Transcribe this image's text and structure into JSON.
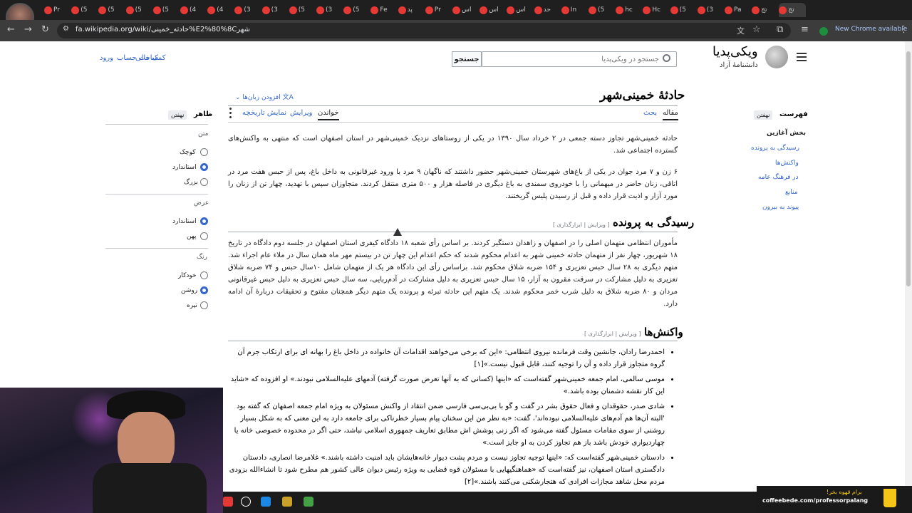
{
  "browser": {
    "tabs": [
      "Pr",
      "(5",
      "(5",
      "(5",
      "(5",
      "(4",
      "(4",
      "(3",
      "(3",
      "(5",
      "(3",
      "(5",
      "Fe",
      "پد",
      "Pr",
      "اس",
      "اس",
      "اس",
      "حد",
      "In",
      "(5",
      "hc",
      "Hc",
      "(5",
      "(3",
      "Pa",
      "تج",
      "تج"
    ],
    "url": "fa.wikipedia.org/wiki/حادثه_خمینی%E2%80%8Cشهر",
    "new_chrome": "New Chrome available"
  },
  "wiki": {
    "logo_title": "ویکی‌پدیا",
    "logo_tagline": "دانشنامهٔ آزاد",
    "search_placeholder": "جستجو در ویکی‌پدیا",
    "search_button": "جستجو",
    "top_links": [
      "کمک مالی",
      "ساخت حساب",
      "ورود"
    ],
    "page_title": "حادثهٔ خمینی‌شهر",
    "add_languages": "افزودن زبان‌ها",
    "tabs": {
      "article": "مقاله",
      "talk": "بحث",
      "read": "خواندن",
      "edit": "ویرایش",
      "history": "نمایش تاریخچه"
    },
    "intro_1": "حادثه خمینی‌شهر تجاوز دسته جمعی در ۲ خرداد سال ۱۳۹۰ در یکی از روستاهای نزدیک خمینی‌شهر در استان اصفهان است که منتهی به واکنش‌های گسترده اجتماعی شد.",
    "intro_2": "۶ زن و ۷ مرد جوان در یکی از باغ‌های شهرستان خمینی‌شهر حضور داشتند که ناگهان ۹ مرد با ورود غیرقانونی به داخل باغ، پس از حبس هفت مرد در اتاقی، زنان حاضر در میهمانی را با خودروی سمندی به باغ دیگری در فاصله هزار و ۵۰۰ متری منتقل کردند. متجاوزان سپس با تهدید، چهار تن از زنان را مورد آزار و اذیت قرار داده و قبل از رسیدن پلیس گریختند.",
    "section_1": "رسیدگی به پرونده",
    "edit_links": "[ ویرایش | ابزارگذاری ]",
    "section_1_text": "مأموران انتظامی متهمان اصلی را در اصفهان و زاهدان دستگیر کردند. بر اساس رأی شعبه ۱۸ دادگاه کیفری استان اصفهان در جلسه دوم دادگاه در تاریخ ۱۸ شهریور، چهار نفر از متهمان حادثه خمینی شهر به اعدام محکوم شدند که حکم اعدام این چهار تن در بیستم مهر ماه همان سال در ملاء عام اجراء شد. متهم دیگری به ۲۸ سال حبس تعزیری و ۱۵۴ ضربه شلاق محکوم شد. براساس رأی این دادگاه هر یک از متهمان شامل ۱۰سال حبس و ۷۴ ضربه شلاق تعزیری به دلیل مشارکت در سرقت مقرون به آزار، ۱۵ سال حبس تعزیری به دلیل مشارکت در آدم‌ربایی، سه سال حبس تعزیری به دلیل حبس غیرقانونی مردان و ۸۰ ضربه شلاق به دلیل شرب خمر محکوم شدند. یک متهم این حادثه تبرئه و پرونده یک متهم دیگر همچنان مفتوح و تحقیقات دربارهٔ آن ادامه دارد.",
    "section_2": "واکنش‌ها",
    "reactions": [
      "احمدرضا رادان، جانشین وقت فرمانده نیروی انتظامی: «این که برخی می‌خواهند اقدامات آن خانواده در داخل باغ را بهانه ای برای ارتکاب جرم آن گروه متجاوز قرار داده و آن را توجیه کنند، قابل قبول نیست.»[۱]",
      "موسی سالمی، امام جمعه خمینی‌شهر گفته‌است که «اینها (کسانی که به آنها تعرض صورت گرفته) آدمهای علیه‌السلامی نبودند.» او افزوده که «شاید این کار نقشه دشمنان بوده باشد.»",
      "شادی صدر، حقوقدان و فعال حقوق بشر در گفت و گو با بی‌بی‌سی فارسی ضمن انتقاد از واکنش مسئولان به ویژه امام جمعه اصفهان که گفته بود 'البته آن‌ها هم آدم‌های علیه‌السلامی نبوده‌اند'، گفت: «به نظر من این سخنان پیام بسیار خطرناکی برای جامعه دارد به این معنی که به شکل بسیار روشنی از سوی مقامات مسئول گفته می‌شود که اگر زنی پوشش اش مطابق تعاریف جمهوری اسلامی نباشد، حتی اگر در محدوده خصوصی خانه یا چهاردیواری خودش باشد باز هم تجاوز کردن به او جایز است.»",
      "دادستان خمینی‌شهر گفته‌است که: «اینها توجیه تجاوز نیست و مردم پشت دیوار خانه‌هایشان باید امنیت داشته باشند.» غلامرضا انصاری، دادستان دادگستری استان اصفهان، نیز گفته‌است که «هماهنگیهایی با مسئولان قوه قضایی به ویژه رئیس دیوان عالی کشور هم مطرح شود تا انشاءالله بزودی مردم محل شاهد مجازات افرادی که هتجارشکنی می‌کنند باشند.»[۲]"
    ],
    "toc": {
      "title": "فهرست",
      "hide": "نهفتن",
      "items": [
        "بخش آغازین",
        "رسیدگی به پرونده",
        "واکنش‌ها",
        "در فرهنگ عامه",
        "منابع",
        "پیوند به بیرون"
      ]
    },
    "appearance": {
      "title": "ظاهر",
      "hide": "نهفتن",
      "text_label": "متن",
      "text_options": [
        "کوچک",
        "استاندارد",
        "بزرگ"
      ],
      "text_selected": 1,
      "width_label": "عرض",
      "width_options": [
        "استاندارد",
        "پهن"
      ],
      "width_selected": 0,
      "color_label": "رنگ",
      "color_options": [
        "خودکار",
        "روشن",
        "تیره"
      ],
      "color_selected": 1
    }
  },
  "overlay": {
    "coffee_title": "برام قهوه بخر!",
    "coffee_url": "coffeebede.com/professorpalang"
  }
}
